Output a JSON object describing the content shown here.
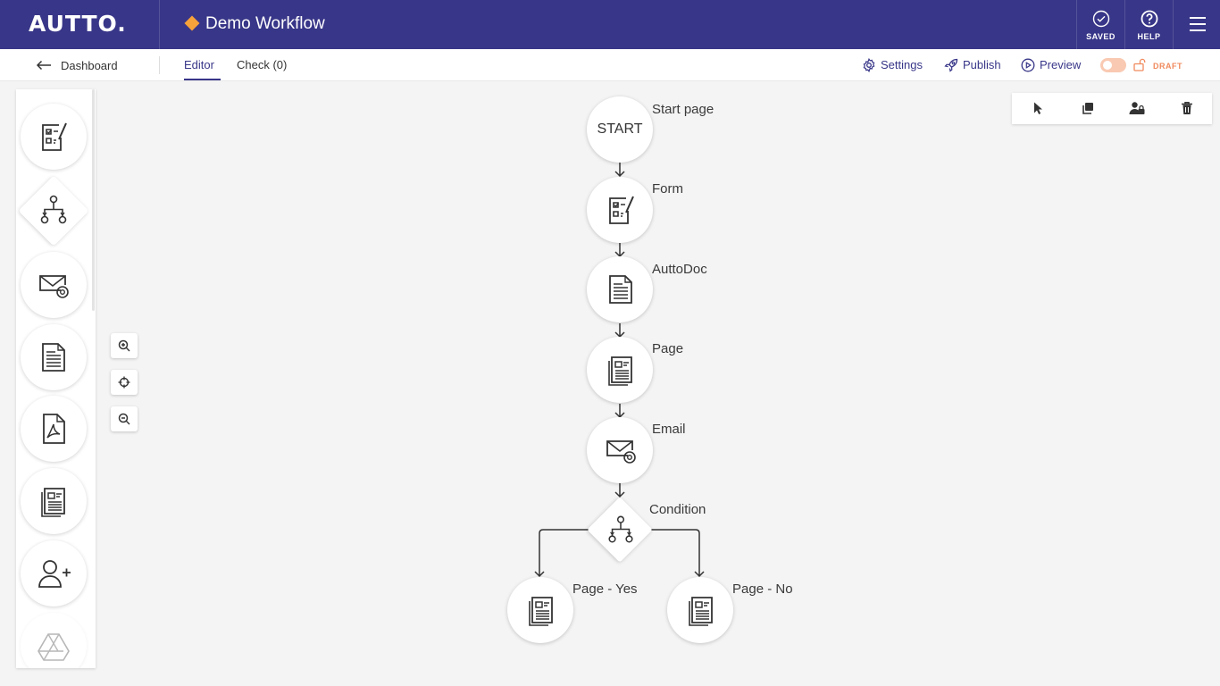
{
  "app": {
    "logo": "AUTTO.",
    "workflow_title": "Demo Workflow"
  },
  "topbar": {
    "saved_label": "SAVED",
    "help_label": "HELP"
  },
  "subbar": {
    "back_label": "Dashboard",
    "tabs": [
      {
        "label": "Editor",
        "active": true
      },
      {
        "label": "Check (0)",
        "active": false
      }
    ],
    "actions": {
      "settings": "Settings",
      "publish": "Publish",
      "preview": "Preview"
    },
    "status": "DRAFT"
  },
  "palette": {
    "items": [
      "form-icon",
      "condition-icon",
      "email-icon",
      "autodoc-icon",
      "pdf-icon",
      "page-icon",
      "add-user-icon",
      "google-drive-icon"
    ]
  },
  "zoom": {
    "controls": [
      "zoom-in-icon",
      "recenter-icon",
      "zoom-out-icon"
    ]
  },
  "right_toolbar": {
    "tools": [
      "pointer-icon",
      "duplicate-icon",
      "assign-user-icon",
      "trash-icon"
    ]
  },
  "workflow": {
    "start": {
      "text": "START",
      "label": "Start page"
    },
    "nodes": [
      {
        "label": "Form",
        "icon": "form-icon"
      },
      {
        "label": "AuttoDoc",
        "icon": "autodoc-icon"
      },
      {
        "label": "Page",
        "icon": "page-icon"
      },
      {
        "label": "Email",
        "icon": "email-icon"
      },
      {
        "label": "Condition",
        "icon": "condition-icon"
      }
    ],
    "branches": [
      {
        "label": "Page - Yes",
        "icon": "page-icon"
      },
      {
        "label": "Page - No",
        "icon": "page-icon"
      }
    ]
  },
  "colors": {
    "brand": "#383688",
    "accent": "#f6a23a",
    "draft": "#f08a5d",
    "canvas": "#f4f4f4"
  }
}
